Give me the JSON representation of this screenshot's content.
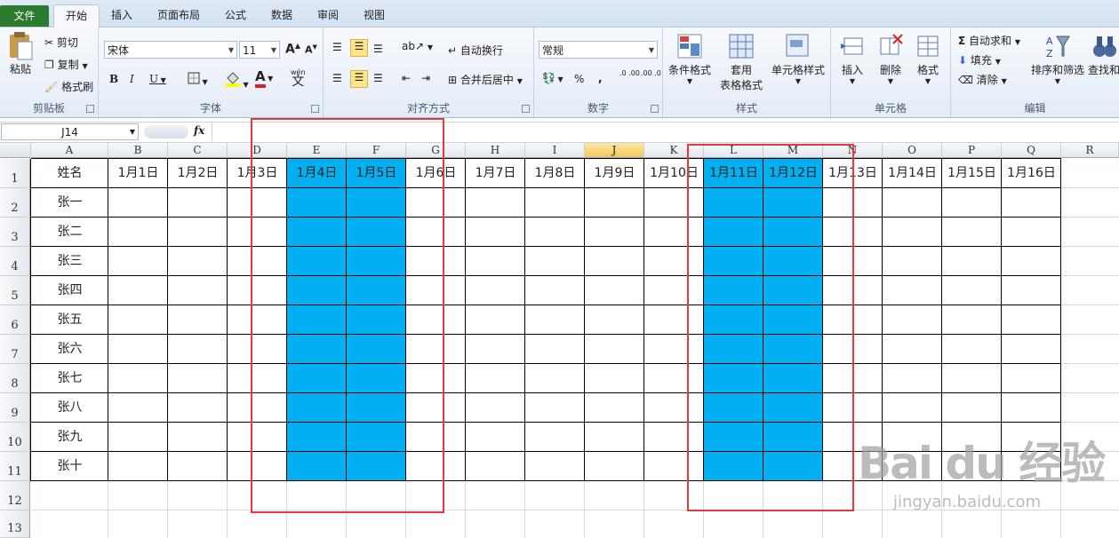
{
  "tabs": [
    "文件",
    "开始",
    "插入",
    "页面布局",
    "公式",
    "数据",
    "审阅",
    "视图"
  ],
  "ribbon": {
    "clipboard": {
      "paste": "粘贴",
      "cut": "剪切",
      "copy": "复制",
      "format_painter": "格式刷",
      "label": "剪贴板"
    },
    "font": {
      "name": "宋体",
      "size": "11",
      "grow": "A",
      "shrink": "A",
      "bold": "B",
      "italic": "I",
      "underline": "U",
      "label": "字体",
      "wen": "wén",
      "wen_char": "文"
    },
    "alignment": {
      "wrap": "自动换行",
      "merge": "合并后居中",
      "label": "对齐方式"
    },
    "number": {
      "format": "常规",
      "percent": "%",
      "comma": ",",
      "inc": ".0 .00",
      "dec": ".00 .0",
      "label": "数字"
    },
    "styles": {
      "cond": "条件格式",
      "table_line1": "套用",
      "table_line2": "表格格式",
      "cell": "单元格样式",
      "label": "样式"
    },
    "cells": {
      "insert": "插入",
      "delete": "删除",
      "format": "格式",
      "label": "单元格"
    },
    "editing": {
      "autosum": "自动求和",
      "fill": "填充",
      "clear": "清除",
      "sort": "排序和筛选",
      "find": "查找和",
      "label": "编辑"
    }
  },
  "formula_bar": {
    "name_box": "J14",
    "fx": "fx",
    "formula": ""
  },
  "columns": [
    "A",
    "B",
    "C",
    "D",
    "E",
    "F",
    "G",
    "H",
    "I",
    "J",
    "K",
    "L",
    "M",
    "N",
    "O",
    "P",
    "Q",
    "R"
  ],
  "rows": [
    "1",
    "2",
    "3",
    "4",
    "5",
    "6",
    "7",
    "8",
    "9",
    "10",
    "11",
    "12",
    "13"
  ],
  "header_row": [
    "姓名",
    "1月1日",
    "1月2日",
    "1月3日",
    "1月4日",
    "1月5日",
    "1月6日",
    "1月7日",
    "1月8日",
    "1月9日",
    "1月10日",
    "1月11日",
    "1月12日",
    "1月13日",
    "1月14日",
    "1月15日",
    "1月16日"
  ],
  "names": [
    "张一",
    "张二",
    "张三",
    "张四",
    "张五",
    "张六",
    "张七",
    "张八",
    "张九",
    "张十"
  ],
  "colors": {
    "highlight": "#00b0f0",
    "red_box": "#e8383d",
    "selected_header": "#f3c85f"
  },
  "watermark": {
    "brand": "Bai du 经验",
    "url": "jingyan.baidu.com"
  }
}
